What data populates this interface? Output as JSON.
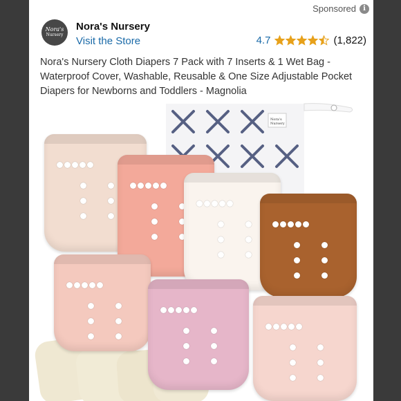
{
  "sponsored": {
    "label": "Sponsored",
    "icon": "info-icon"
  },
  "store": {
    "name": "Nora's Nursery",
    "link": "Visit the Store",
    "logo_text_line1": "Nora's",
    "logo_text_line2": "Nursery"
  },
  "rating": {
    "value": "4.7",
    "stars": 4.5,
    "count": "(1,822)",
    "star_color": "#e7a11b"
  },
  "product": {
    "title": "Nora's Nursery Cloth Diapers 7 Pack with 7 Inserts & 1 Wet Bag - Waterproof Cover, Washable, Reusable & One Size Adjustable Pocket Diapers for Newborns and Toddlers - Magnolia"
  },
  "image": {
    "wet_bag_brand_tag": "Nora's Nursery",
    "diaper_colors": [
      "#f2ddd0",
      "#f3a99a",
      "#faf4ee",
      "#a9622e",
      "#f4c9be",
      "#e6b6c9",
      "#f6d6ce"
    ],
    "insert_color": "#efe8d2"
  }
}
